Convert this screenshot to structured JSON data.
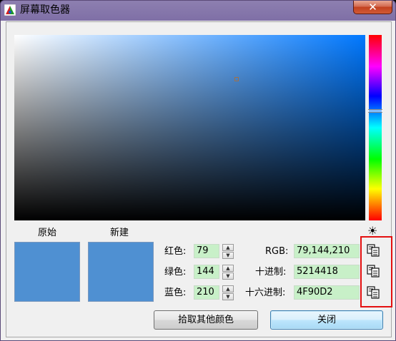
{
  "window": {
    "title": "屏幕取色器",
    "close_glyph": "✕"
  },
  "swatches": {
    "original_label": "原始",
    "new_label": "新建",
    "color": "#4f90d2"
  },
  "channels": [
    {
      "label": "红色:",
      "value": "79"
    },
    {
      "label": "绿色:",
      "value": "144"
    },
    {
      "label": "蓝色:",
      "value": "210"
    }
  ],
  "formats": [
    {
      "label": "RGB:",
      "value": "79,144,210"
    },
    {
      "label": "十进制:",
      "value": "5214418"
    },
    {
      "label": "十六进制:",
      "value": "4F90D2"
    }
  ],
  "brightness_glyph": "☀",
  "buttons": {
    "pick_other": "拾取其他颜色",
    "close": "关闭"
  },
  "colors": {
    "selected": "#4f90d2",
    "field_bg": "#c8f0c8",
    "highlight": "#e41010"
  },
  "icons": {
    "copy": "copy-icon",
    "app": "color-picker-app-icon",
    "brightness": "sun-icon"
  }
}
